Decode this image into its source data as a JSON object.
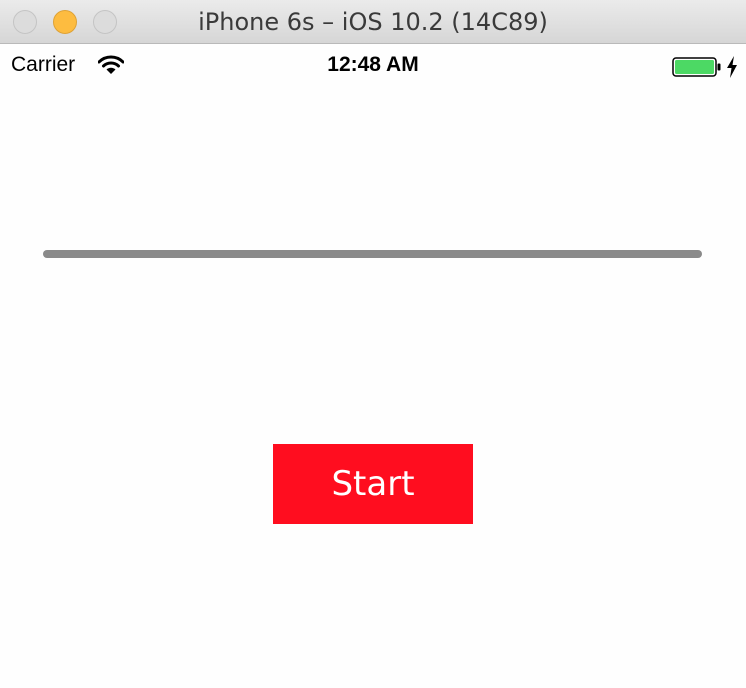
{
  "window": {
    "title": "iPhone 6s – iOS 10.2 (14C89)"
  },
  "status_bar": {
    "carrier": "Carrier",
    "time": "12:48 AM",
    "battery_level": 1.0,
    "charging": true,
    "battery_color": "#4cd964"
  },
  "progress": {
    "value": 0
  },
  "start_button": {
    "label": "Start",
    "color": "#ff0d1f"
  }
}
